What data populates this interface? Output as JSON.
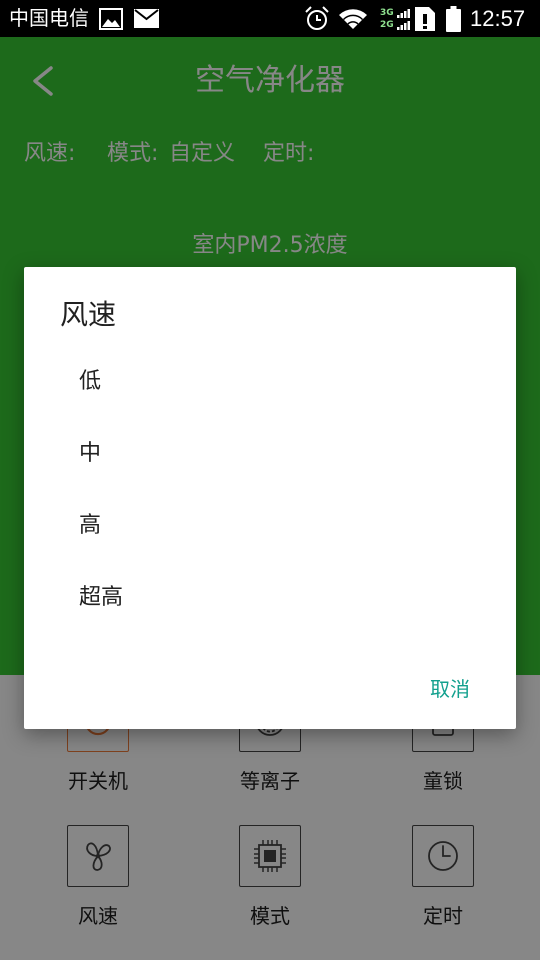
{
  "status_bar": {
    "carrier": "中国电信",
    "network_3g": "3G",
    "network_2g": "2G",
    "time": "12:57",
    "left_icons": [
      "image-icon",
      "mail-icon"
    ],
    "right_icons": [
      "alarm-icon",
      "wifi-icon",
      "signal-icon",
      "sim-icon",
      "battery-icon"
    ]
  },
  "header": {
    "back_icon": "chevron-left-icon",
    "title": "空气净化器"
  },
  "status_row": {
    "wind_label": "风速:",
    "mode_label": "模式:",
    "mode_value": "自定义",
    "timer_label": "定时:"
  },
  "pm": {
    "label": "室内PM2.5浓度"
  },
  "controls": [
    {
      "label": "开关机",
      "icon": "power-icon"
    },
    {
      "label": "等离子",
      "icon": "plasma-icon"
    },
    {
      "label": "童锁",
      "icon": "lock-icon"
    },
    {
      "label": "风速",
      "icon": "fan-icon"
    },
    {
      "label": "模式",
      "icon": "chip-icon"
    },
    {
      "label": "定时",
      "icon": "clock-icon"
    }
  ],
  "dialog": {
    "title": "风速",
    "options": [
      "低",
      "中",
      "高",
      "超高"
    ],
    "cancel_label": "取消"
  },
  "colors": {
    "header_green": "#38c934",
    "accent_teal": "#12a08e",
    "power_orange": "#f07b3a",
    "scrim": "rgba(0,0,0,0.47)"
  }
}
